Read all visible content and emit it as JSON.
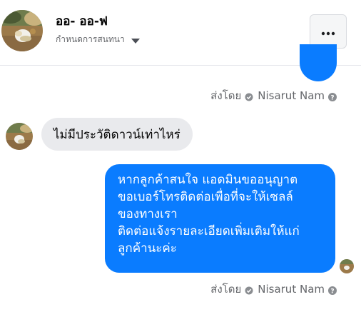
{
  "header": {
    "contact_name": "ออ- ออ-ฟ",
    "conversation_settings_label": "กำหนดการสนทนา",
    "more_icon": "more-horizontal-icon"
  },
  "thread": {
    "messages": [
      {
        "direction": "incoming",
        "text": "ไม่มีประวัติดาวน์เท่าไหร่"
      },
      {
        "direction": "outgoing",
        "lines": [
          "หากลูกค้าสนใจ แอดมินขออนุญาต",
          "ขอเบอร์โทรติดต่อเพื่อที่จะให้เซลล์",
          "ของทางเรา",
          "ติดต่อแจ้งรายละเอียดเพิ่มเติมให้แก่",
          "ลูกค้านะค่ะ"
        ]
      }
    ],
    "sent_by": [
      {
        "label": "ส่งโดย",
        "name": "Nisarut Nam"
      },
      {
        "label": "ส่งโดย",
        "name": "Nisarut Nam"
      }
    ]
  },
  "colors": {
    "outgoing_bubble": "#0a7cff",
    "incoming_bubble": "#e9eaed",
    "meta_text": "#65676b"
  }
}
